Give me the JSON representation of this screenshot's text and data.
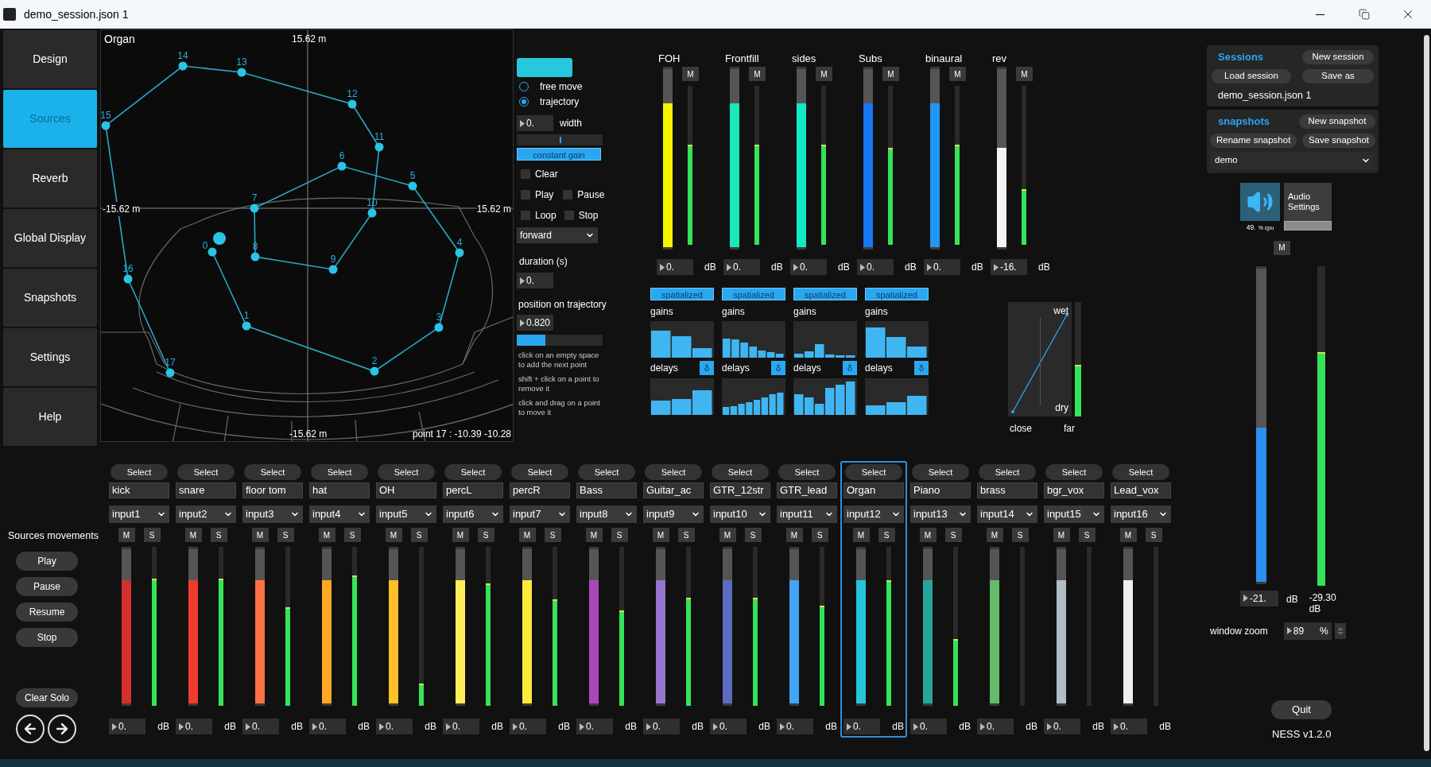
{
  "window": {
    "title": "demo_session.json 1"
  },
  "nav": [
    {
      "label": "Design",
      "selected": false
    },
    {
      "label": "Sources",
      "selected": true
    },
    {
      "label": "Reverb",
      "selected": false
    },
    {
      "label": "Global Display",
      "selected": false
    },
    {
      "label": "Snapshots",
      "selected": false
    },
    {
      "label": "Settings",
      "selected": false
    },
    {
      "label": "Help",
      "selected": false
    }
  ],
  "movements": {
    "title": "Sources movements",
    "buttons": [
      "Play",
      "Pause",
      "Resume",
      "Stop"
    ],
    "clear_solo": "Clear Solo"
  },
  "map": {
    "source": "Organ",
    "top": "15.62 m",
    "left": "-15.62 m",
    "right": "15.62 m",
    "bottom": "-15.62 m",
    "status": "point 17 : -10.39 -10.28",
    "points": [
      "0",
      "1",
      "2",
      "3",
      "4",
      "5",
      "6",
      "7",
      "8",
      "9",
      "10",
      "11",
      "12",
      "13",
      "14",
      "15",
      "16",
      "17"
    ]
  },
  "trajectory": {
    "modes": [
      {
        "label": "free move",
        "selected": false
      },
      {
        "label": "trajectory",
        "selected": true
      }
    ],
    "width": {
      "value": "0.",
      "label": "width",
      "level": 0.5
    },
    "constant_gain": {
      "label": "constant gain",
      "on": true
    },
    "checks": [
      {
        "label": "Clear",
        "checked": false
      },
      {
        "label": "Play",
        "checked": false
      },
      {
        "label": "Pause",
        "checked": false
      },
      {
        "label": "Loop",
        "checked": false
      },
      {
        "label": "Stop",
        "checked": false
      }
    ],
    "direction": "forward",
    "duration": {
      "label": "duration (s)",
      "value": "0."
    },
    "position": {
      "label": "position on trajectory",
      "value": "0.820",
      "level": 0.33
    },
    "help": [
      "click on an empty space to add the next point",
      "shift + click on a point to remove it",
      "click and drag on a point to move it"
    ]
  },
  "buses": [
    {
      "name": "FOH",
      "color": "#f5f500",
      "fader": {
        "level": 0.81
      },
      "meter": {
        "level": 0.63
      },
      "mute": "M",
      "value": "0.",
      "unit": "dB",
      "spatial": {
        "toggle": "spatialized",
        "on": true,
        "gains": "gains",
        "delays": "delays",
        "delta": "δ"
      }
    },
    {
      "name": "Frontfill",
      "color": "#1de9b6",
      "fader": {
        "level": 0.81
      },
      "meter": {
        "level": 0.63
      },
      "mute": "M",
      "value": "0.",
      "unit": "dB",
      "spatial": {
        "toggle": "spatialized",
        "on": true,
        "gains": "gains",
        "delays": "delays",
        "delta": "δ"
      }
    },
    {
      "name": "sides",
      "color": "#12e8c4",
      "fader": {
        "level": 0.81
      },
      "meter": {
        "level": 0.63
      },
      "mute": "M",
      "value": "0.",
      "unit": "dB",
      "spatial": {
        "toggle": "spatialized",
        "on": true,
        "gains": "gains",
        "delays": "delays",
        "delta": "δ"
      }
    },
    {
      "name": "Subs",
      "color": "#1976f2",
      "fader": {
        "level": 0.81
      },
      "meter": {
        "level": 0.61
      },
      "mute": "M",
      "value": "0.",
      "unit": "dB",
      "spatial": {
        "toggle": "spatialized",
        "on": true,
        "gains": "gains",
        "delays": "delays",
        "delta": "δ"
      }
    },
    {
      "name": "binaural",
      "color": "#2196f3",
      "fader": {
        "level": 0.81
      },
      "meter": {
        "level": 0.63
      },
      "mute": "M",
      "value": "0.",
      "unit": "dB"
    },
    {
      "name": "rev",
      "color": "#f5f5f5",
      "fader": {
        "level": 0.56
      },
      "meter": {
        "level": 0.35
      },
      "mute": "M",
      "value": "-16.",
      "unit": "dB"
    }
  ],
  "reverb": {
    "wet": "wet",
    "dry": "dry",
    "close": "close",
    "far": "far",
    "meter": {
      "level": 0.45
    }
  },
  "sessions": {
    "title": "Sessions",
    "buttons": [
      "New session",
      "Load session",
      "Save as"
    ],
    "file": "demo_session.json 1"
  },
  "snapshots": {
    "title": "snapshots",
    "buttons": [
      "New snapshot",
      "Rename snapshot",
      "Save snapshot"
    ],
    "current": "demo"
  },
  "audio": {
    "on": true,
    "settings": "Audio Settings",
    "cpu": "49.",
    "cpu_unit": "% cpu"
  },
  "master": {
    "mute": "M",
    "fader": {
      "level": 0.49
    },
    "meter": {
      "level": 0.73
    },
    "value": "-21.",
    "unit": "dB",
    "reading": "-29.30",
    "reading_unit": "dB"
  },
  "zoom": {
    "label": "window zoom",
    "value": "89",
    "unit": "%"
  },
  "quit": "Quit",
  "version": "NESS v1.2.0",
  "channels": [
    {
      "select": "Select",
      "name": "kick",
      "input": "input1",
      "mute": "M",
      "solo": "S",
      "color": "#d32f2f",
      "fader": {
        "level": 0.8
      },
      "meter": {
        "level": 0.8
      },
      "value": "0.",
      "unit": "dB",
      "selected": false
    },
    {
      "select": "Select",
      "name": "snare",
      "input": "input2",
      "mute": "M",
      "solo": "S",
      "color": "#f03c2e",
      "fader": {
        "level": 0.8
      },
      "meter": {
        "level": 0.8
      },
      "value": "0.",
      "unit": "dB",
      "selected": false
    },
    {
      "select": "Select",
      "name": "floor tom",
      "input": "input3",
      "mute": "M",
      "solo": "S",
      "color": "#ff7043",
      "fader": {
        "level": 0.8
      },
      "meter": {
        "level": 0.62
      },
      "value": "0.",
      "unit": "dB",
      "selected": false
    },
    {
      "select": "Select",
      "name": "hat",
      "input": "input4",
      "mute": "M",
      "solo": "S",
      "color": "#ffa726",
      "fader": {
        "level": 0.8
      },
      "meter": {
        "level": 0.82
      },
      "value": "0.",
      "unit": "dB",
      "selected": false
    },
    {
      "select": "Select",
      "name": "OH",
      "input": "input5",
      "mute": "M",
      "solo": "S",
      "color": "#ffc02a",
      "fader": {
        "level": 0.8
      },
      "meter": {
        "level": 0.14
      },
      "value": "0.",
      "unit": "dB",
      "selected": false
    },
    {
      "select": "Select",
      "name": "percL",
      "input": "input6",
      "mute": "M",
      "solo": "S",
      "color": "#ffee58",
      "fader": {
        "level": 0.8
      },
      "meter": {
        "level": 0.77
      },
      "value": "0.",
      "unit": "dB",
      "selected": false
    },
    {
      "select": "Select",
      "name": "percR",
      "input": "input7",
      "mute": "M",
      "solo": "S",
      "color": "#ffeb3b",
      "fader": {
        "level": 0.8
      },
      "meter": {
        "level": 0.67
      },
      "value": "0.",
      "unit": "dB",
      "selected": false
    },
    {
      "select": "Select",
      "name": "Bass",
      "input": "input8",
      "mute": "M",
      "solo": "S",
      "color": "#ab47bc",
      "fader": {
        "level": 0.8
      },
      "meter": {
        "level": 0.6
      },
      "value": "0.",
      "unit": "dB",
      "selected": false
    },
    {
      "select": "Select",
      "name": "Guitar_ac",
      "input": "input9",
      "mute": "M",
      "solo": "S",
      "color": "#9575cd",
      "fader": {
        "level": 0.8
      },
      "meter": {
        "level": 0.68
      },
      "value": "0.",
      "unit": "dB",
      "selected": false
    },
    {
      "select": "Select",
      "name": "GTR_12str",
      "input": "input10",
      "mute": "M",
      "solo": "S",
      "color": "#5c6bc0",
      "fader": {
        "level": 0.8
      },
      "meter": {
        "level": 0.68
      },
      "value": "0.",
      "unit": "dB",
      "selected": false
    },
    {
      "select": "Select",
      "name": "GTR_lead",
      "input": "input11",
      "mute": "M",
      "solo": "S",
      "color": "#42a5f5",
      "fader": {
        "level": 0.8
      },
      "meter": {
        "level": 0.63
      },
      "value": "0.",
      "unit": "dB",
      "selected": false
    },
    {
      "select": "Select",
      "name": "Organ",
      "input": "input12",
      "mute": "M",
      "solo": "S",
      "color": "#26c6da",
      "fader": {
        "level": 0.8
      },
      "meter": {
        "level": 0.79
      },
      "value": "0.",
      "unit": "dB",
      "selected": true
    },
    {
      "select": "Select",
      "name": "Piano",
      "input": "input13",
      "mute": "M",
      "solo": "S",
      "color": "#26a69a",
      "fader": {
        "level": 0.8
      },
      "meter": {
        "level": 0.42
      },
      "value": "0.",
      "unit": "dB",
      "selected": false
    },
    {
      "select": "Select",
      "name": "brass",
      "input": "input14",
      "mute": "M",
      "solo": "S",
      "color": "#66bb6a",
      "fader": {
        "level": 0.8
      },
      "meter": {
        "level": 0
      },
      "value": "0.",
      "unit": "dB",
      "selected": false
    },
    {
      "select": "Select",
      "name": "bgr_vox",
      "input": "input15",
      "mute": "M",
      "solo": "S",
      "color": "#b0bec5",
      "fader": {
        "level": 0.8
      },
      "meter": {
        "level": 0
      },
      "value": "0.",
      "unit": "dB",
      "selected": false
    },
    {
      "select": "Select",
      "name": "Lead_vox",
      "input": "input16",
      "mute": "M",
      "solo": "S",
      "color": "#eeeeee",
      "fader": {
        "level": 0.8
      },
      "meter": {
        "level": 0
      },
      "value": "0.",
      "unit": "dB",
      "selected": false
    }
  ]
}
